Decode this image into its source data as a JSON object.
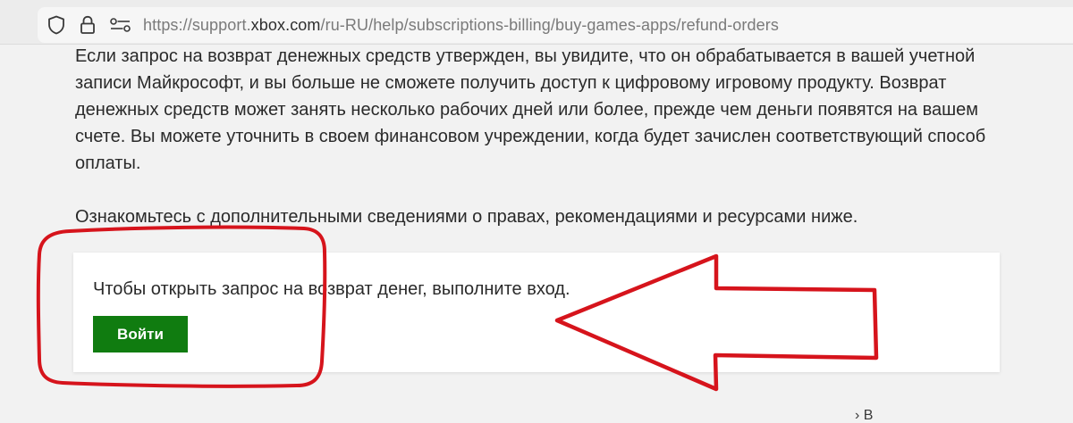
{
  "browser": {
    "url_prefix": "https://support.",
    "url_domain": "xbox.com",
    "url_path": "/ru-RU/help/subscriptions-billing/buy-games-apps/refund-orders",
    "icons": [
      "shield-icon",
      "lock-icon",
      "site-permissions-icon"
    ]
  },
  "article": {
    "paragraph_1": "Если запрос на возврат денежных средств утвержден, вы увидите, что он обрабатывается в вашей учетной записи Майкрософт, и вы больше не сможете получить доступ к цифровому игровому продукту. Возврат денежных средств может занять несколько рабочих дней или более, прежде чем деньги появятся на вашем счете. Вы можете уточнить в своем финансовом учреждении, когда будет зачислен соответствующий способ оплаты.",
    "paragraph_2": "Ознакомьтесь с дополнительными сведениями о правах, рекомендациями и ресурсами ниже."
  },
  "signin_card": {
    "text": "Чтобы открыть запрос на возврат денег, выполните вход.",
    "button_label": "Войти"
  },
  "footer": {
    "corner_link": "› В"
  },
  "colors": {
    "button_green": "#107c10",
    "annotation_red": "#d6141c",
    "page_background": "#f2f2f2"
  }
}
